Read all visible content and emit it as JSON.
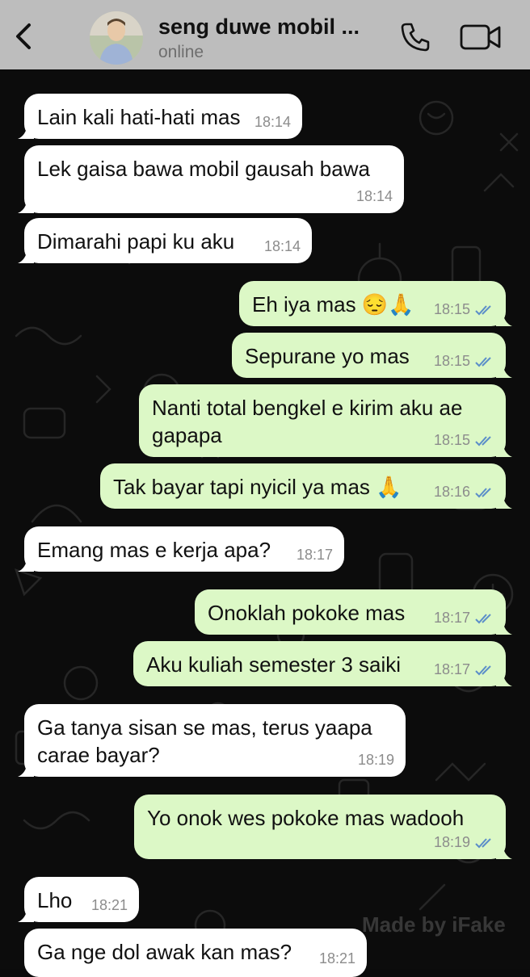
{
  "header": {
    "title": "seng duwe mobil ...",
    "status": "online",
    "back_icon": "chevron-left-icon",
    "call_icon": "phone-icon",
    "video_icon": "video-camera-icon",
    "bg_color": "#bdbdbd"
  },
  "colors": {
    "incoming_bubble": "#ffffff",
    "outgoing_bubble": "#dcf8c6",
    "read_receipt": "#5b8ec9",
    "chat_background": "#0c0c0c"
  },
  "messages": [
    {
      "dir": "in",
      "text": "Lain kali hati-hati mas",
      "time": "18:14"
    },
    {
      "dir": "in",
      "text": "Lek gaisa bawa mobil gausah bawa",
      "time": "18:14"
    },
    {
      "dir": "in",
      "text": "Dimarahi papi ku aku",
      "time": "18:14"
    },
    {
      "dir": "out",
      "text": "Eh iya mas 😔🙏",
      "time": "18:15",
      "read": true
    },
    {
      "dir": "out",
      "text": "Sepurane yo mas",
      "time": "18:15",
      "read": true
    },
    {
      "dir": "out",
      "text": "Nanti total bengkel e kirim aku ae gapapa",
      "time": "18:15",
      "read": true
    },
    {
      "dir": "out",
      "text": "Tak bayar tapi nyicil ya mas 🙏",
      "time": "18:16",
      "read": true
    },
    {
      "dir": "in",
      "text": "Emang mas e kerja apa?",
      "time": "18:17"
    },
    {
      "dir": "out",
      "text": "Onoklah pokoke mas",
      "time": "18:17",
      "read": true
    },
    {
      "dir": "out",
      "text": "Aku kuliah semester 3 saiki",
      "time": "18:17",
      "read": true
    },
    {
      "dir": "in",
      "text": "Ga tanya sisan se mas, terus yaapa carae bayar?",
      "time": "18:19"
    },
    {
      "dir": "out",
      "text": "Yo onok wes pokoke mas wadooh",
      "time": "18:19",
      "read": true
    },
    {
      "dir": "in",
      "text": "Lho",
      "time": "18:21"
    },
    {
      "dir": "in",
      "text": "Ga nge dol awak kan mas?",
      "time": "18:21"
    }
  ],
  "watermark": "Made by iFake"
}
